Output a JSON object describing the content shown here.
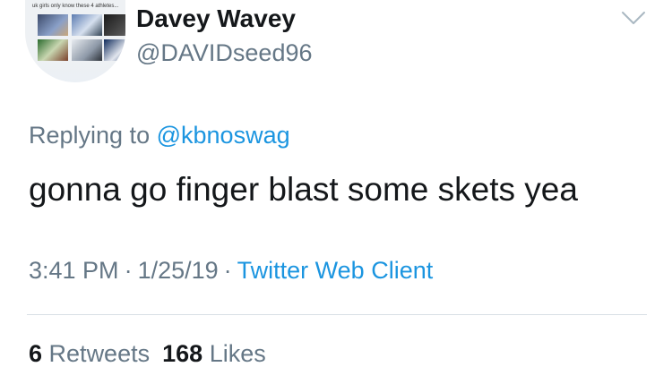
{
  "author": {
    "display_name": "Davey Wavey",
    "handle": "@DAVIDseed96",
    "avatar_caption": "uk girls only know these 4 athletes..."
  },
  "reply": {
    "prefix": "Replying to",
    "mention": "@kbnoswag"
  },
  "tweet": {
    "text": "gonna go finger blast some skets yea"
  },
  "meta": {
    "time": "3:41 PM",
    "date": "1/25/19",
    "separator": "·",
    "client": "Twitter Web Client"
  },
  "stats": {
    "retweets_count": "6",
    "retweets_label": "Retweets",
    "likes_count": "168",
    "likes_label": "Likes"
  },
  "icons": {
    "menu": "chevron-down-icon"
  },
  "colors": {
    "link": "#1b95e0",
    "secondary_text": "#657786",
    "primary_text": "#14171a",
    "divider": "#d8dfe5"
  }
}
